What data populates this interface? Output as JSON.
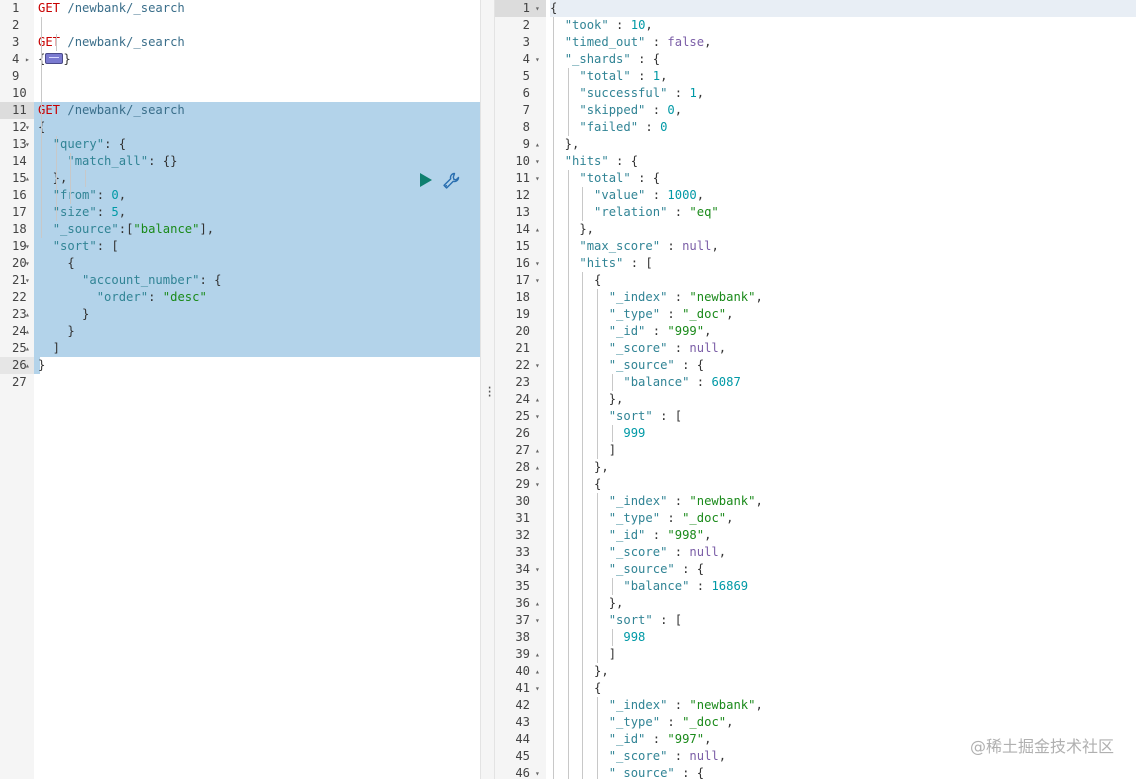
{
  "request_editor": {
    "lines": [
      {
        "n": "1",
        "t": "GET /newbank/_search"
      },
      {
        "n": "2",
        "t": ""
      },
      {
        "n": "3",
        "t": "GET /newbank/_search"
      },
      {
        "n": "4",
        "t": "{…}",
        "fold": "▸"
      },
      {
        "n": "9",
        "t": ""
      },
      {
        "n": "10",
        "t": ""
      },
      {
        "n": "11",
        "t": "GET /newbank/_search"
      },
      {
        "n": "12",
        "t": "{",
        "fold": "▾"
      },
      {
        "n": "13",
        "t": "  \"query\": {",
        "fold": "▾"
      },
      {
        "n": "14",
        "t": "    \"match_all\": {}"
      },
      {
        "n": "15",
        "t": "  },",
        "fold": "▴"
      },
      {
        "n": "16",
        "t": "  \"from\": 0,"
      },
      {
        "n": "17",
        "t": "  \"size\": 5,"
      },
      {
        "n": "18",
        "t": "  \"_source\":[\"balance\"],"
      },
      {
        "n": "19",
        "t": "  \"sort\": [",
        "fold": "▾"
      },
      {
        "n": "20",
        "t": "    {",
        "fold": "▾"
      },
      {
        "n": "21",
        "t": "      \"account_number\": {",
        "fold": "▾"
      },
      {
        "n": "22",
        "t": "        \"order\": \"desc\""
      },
      {
        "n": "23",
        "t": "      }",
        "fold": "▴"
      },
      {
        "n": "24",
        "t": "    }",
        "fold": "▴"
      },
      {
        "n": "25",
        "t": "  ]",
        "fold": "▴"
      },
      {
        "n": "26",
        "t": "}",
        "fold": "▴"
      },
      {
        "n": "27",
        "t": ""
      }
    ],
    "run_icon": "play-icon",
    "settings_icon": "wrench-icon"
  },
  "response_viewer": {
    "lines": [
      {
        "n": "1",
        "t": "{",
        "fold": "▾"
      },
      {
        "n": "2",
        "t": "  \"took\" : 10,"
      },
      {
        "n": "3",
        "t": "  \"timed_out\" : false,"
      },
      {
        "n": "4",
        "t": "  \"_shards\" : {",
        "fold": "▾"
      },
      {
        "n": "5",
        "t": "    \"total\" : 1,"
      },
      {
        "n": "6",
        "t": "    \"successful\" : 1,"
      },
      {
        "n": "7",
        "t": "    \"skipped\" : 0,"
      },
      {
        "n": "8",
        "t": "    \"failed\" : 0"
      },
      {
        "n": "9",
        "t": "  },",
        "fold": "▴"
      },
      {
        "n": "10",
        "t": "  \"hits\" : {",
        "fold": "▾"
      },
      {
        "n": "11",
        "t": "    \"total\" : {",
        "fold": "▾"
      },
      {
        "n": "12",
        "t": "      \"value\" : 1000,"
      },
      {
        "n": "13",
        "t": "      \"relation\" : \"eq\""
      },
      {
        "n": "14",
        "t": "    },",
        "fold": "▴"
      },
      {
        "n": "15",
        "t": "    \"max_score\" : null,"
      },
      {
        "n": "16",
        "t": "    \"hits\" : [",
        "fold": "▾"
      },
      {
        "n": "17",
        "t": "      {",
        "fold": "▾"
      },
      {
        "n": "18",
        "t": "        \"_index\" : \"newbank\","
      },
      {
        "n": "19",
        "t": "        \"_type\" : \"_doc\","
      },
      {
        "n": "20",
        "t": "        \"_id\" : \"999\","
      },
      {
        "n": "21",
        "t": "        \"_score\" : null,"
      },
      {
        "n": "22",
        "t": "        \"_source\" : {",
        "fold": "▾"
      },
      {
        "n": "23",
        "t": "          \"balance\" : 6087"
      },
      {
        "n": "24",
        "t": "        },",
        "fold": "▴"
      },
      {
        "n": "25",
        "t": "        \"sort\" : [",
        "fold": "▾"
      },
      {
        "n": "26",
        "t": "          999"
      },
      {
        "n": "27",
        "t": "        ]",
        "fold": "▴"
      },
      {
        "n": "28",
        "t": "      },",
        "fold": "▴"
      },
      {
        "n": "29",
        "t": "      {",
        "fold": "▾"
      },
      {
        "n": "30",
        "t": "        \"_index\" : \"newbank\","
      },
      {
        "n": "31",
        "t": "        \"_type\" : \"_doc\","
      },
      {
        "n": "32",
        "t": "        \"_id\" : \"998\","
      },
      {
        "n": "33",
        "t": "        \"_score\" : null,"
      },
      {
        "n": "34",
        "t": "        \"_source\" : {",
        "fold": "▾"
      },
      {
        "n": "35",
        "t": "          \"balance\" : 16869"
      },
      {
        "n": "36",
        "t": "        },",
        "fold": "▴"
      },
      {
        "n": "37",
        "t": "        \"sort\" : [",
        "fold": "▾"
      },
      {
        "n": "38",
        "t": "          998"
      },
      {
        "n": "39",
        "t": "        ]",
        "fold": "▴"
      },
      {
        "n": "40",
        "t": "      },",
        "fold": "▴"
      },
      {
        "n": "41",
        "t": "      {",
        "fold": "▾"
      },
      {
        "n": "42",
        "t": "        \"_index\" : \"newbank\","
      },
      {
        "n": "43",
        "t": "        \"_type\" : \"_doc\","
      },
      {
        "n": "44",
        "t": "        \"_id\" : \"997\","
      },
      {
        "n": "45",
        "t": "        \"_score\" : null,"
      },
      {
        "n": "46",
        "t": "        \"_source\" : {",
        "fold": "▾"
      }
    ]
  },
  "watermark": "@稀土掘金技术社区"
}
